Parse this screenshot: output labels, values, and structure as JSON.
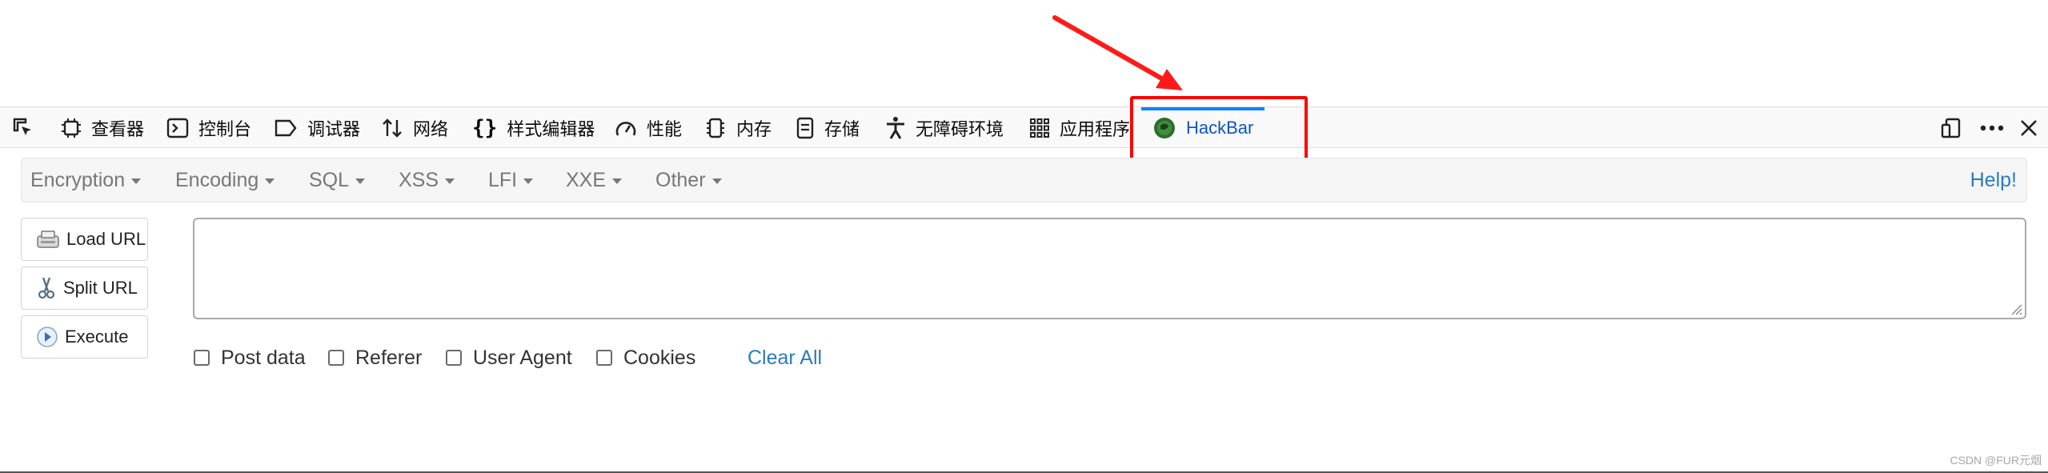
{
  "devtools": {
    "tabs": [
      {
        "label": "查看器",
        "icon": "inspector-icon"
      },
      {
        "label": "控制台",
        "icon": "console-icon"
      },
      {
        "label": "调试器",
        "icon": "debugger-icon"
      },
      {
        "label": "网络",
        "icon": "network-icon"
      },
      {
        "label": "样式编辑器",
        "icon": "style-editor-icon"
      },
      {
        "label": "性能",
        "icon": "performance-icon"
      },
      {
        "label": "内存",
        "icon": "memory-icon"
      },
      {
        "label": "存储",
        "icon": "storage-icon"
      },
      {
        "label": "无障碍环境",
        "icon": "accessibility-icon"
      },
      {
        "label": "应用程序",
        "icon": "application-icon"
      },
      {
        "label": "HackBar",
        "icon": "hackbar-icon",
        "selected": true
      }
    ],
    "selected_color": "#0a57c4",
    "highlight_color": "#ff0000"
  },
  "hackbar": {
    "menu": [
      "Encryption",
      "Encoding",
      "SQL",
      "XSS",
      "LFI",
      "XXE",
      "Other"
    ],
    "help": "Help!",
    "buttons": {
      "load_url": "Load URL",
      "split_url": "Split URL",
      "execute": "Execute"
    },
    "url_value": "",
    "options": {
      "post_data": "Post data",
      "referer": "Referer",
      "user_agent": "User Agent",
      "cookies": "Cookies"
    },
    "clear_all": "Clear All"
  },
  "watermark": "CSDN @FUR元烟"
}
